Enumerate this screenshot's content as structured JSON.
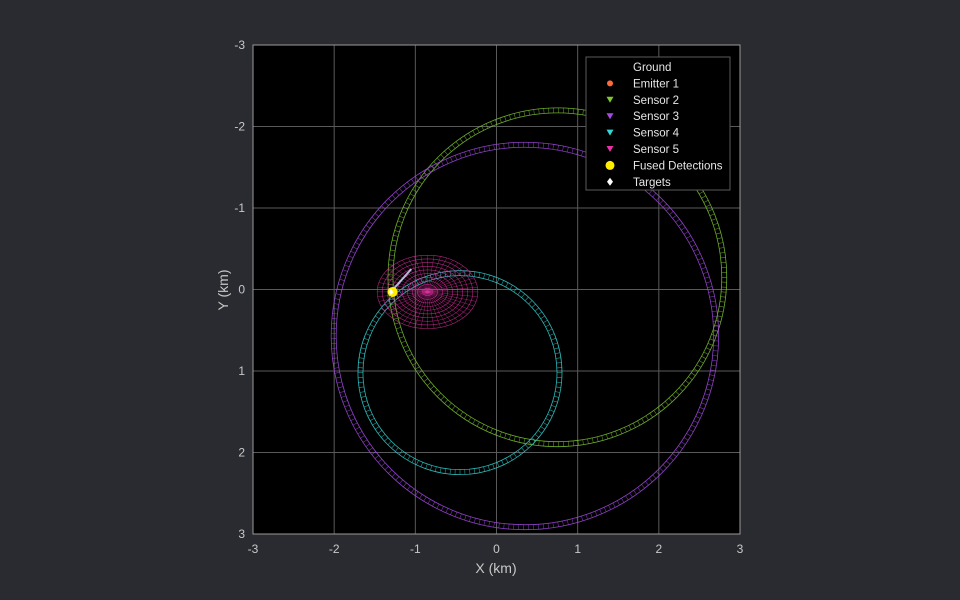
{
  "chart_data": {
    "type": "scatter",
    "title": "",
    "xlabel": "X (km)",
    "ylabel": "Y (km)",
    "xlim": [
      -3,
      3
    ],
    "ylim": [
      -3,
      3
    ],
    "y_reversed": true,
    "grid": true,
    "x_ticks": [
      "-3",
      "-2",
      "-1",
      "0",
      "1",
      "2",
      "3"
    ],
    "y_ticks": [
      "-3",
      "-2",
      "-1",
      "0",
      "1",
      "2",
      "3"
    ],
    "legend_position": "top-right",
    "legend": [
      {
        "name": "Ground",
        "marker": "none",
        "color": "#ffffff"
      },
      {
        "name": "Emitter 1",
        "marker": "circle",
        "color": "#ff6a3a"
      },
      {
        "name": "Sensor 2",
        "marker": "triangle-down",
        "color": "#7ec832"
      },
      {
        "name": "Sensor 3",
        "marker": "triangle-down",
        "color": "#a64ae6"
      },
      {
        "name": "Sensor 4",
        "marker": "triangle-down",
        "color": "#33d6d6"
      },
      {
        "name": "Sensor 5",
        "marker": "triangle-down",
        "color": "#e632a6"
      },
      {
        "name": "Fused Detections",
        "marker": "circle",
        "color": "#ffee00"
      },
      {
        "name": "Targets",
        "marker": "diamond",
        "color": "#ffffff"
      }
    ],
    "coverage_circles": [
      {
        "name": "Sensor 2",
        "color": "#7ec832",
        "center": [
          0.75,
          -0.15
        ],
        "radius": 2.05
      },
      {
        "name": "Sensor 3",
        "color": "#a64ae6",
        "center": [
          0.35,
          0.57
        ],
        "radius": 2.35
      },
      {
        "name": "Sensor 4",
        "color": "#33d6d6",
        "center": [
          -0.45,
          1.02
        ],
        "radius": 1.22
      }
    ],
    "emitter_region": {
      "name": "Sensor 5",
      "color": "#e632a6",
      "center": [
        -0.85,
        0.03
      ],
      "rx": 0.62,
      "ry": 0.45
    },
    "fused_detections": [
      {
        "x": -1.28,
        "y": 0.03
      }
    ],
    "targets": [
      {
        "x": -1.3,
        "y": 0.03
      }
    ],
    "target_path": [
      [
        -1.32,
        0.05
      ],
      [
        -1.05,
        -0.25
      ]
    ]
  }
}
